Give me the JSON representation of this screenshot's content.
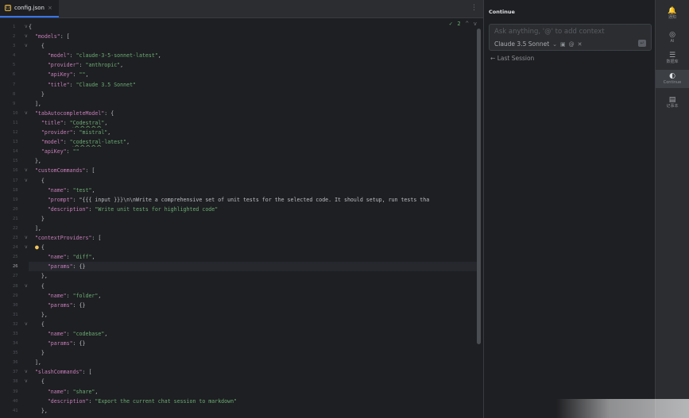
{
  "editor": {
    "tab": {
      "filename": "config.json",
      "close": "×"
    },
    "menu_icon": "⋮",
    "inspection": {
      "count": "2",
      "up": "^",
      "down": "v"
    },
    "current_line": 26,
    "lines": [
      {
        "n": "1",
        "t": "{",
        "fold": "v"
      },
      {
        "n": "2",
        "t": "  \"models\": [",
        "fold": "v"
      },
      {
        "n": "3",
        "t": "    {",
        "fold": "v"
      },
      {
        "n": "4",
        "t": "      \"model\": \"claude-3-5-sonnet-latest\","
      },
      {
        "n": "5",
        "t": "      \"provider\": \"anthropic\","
      },
      {
        "n": "6",
        "t": "      \"apiKey\": \"\","
      },
      {
        "n": "7",
        "t": "      \"title\": \"Claude 3.5 Sonnet\""
      },
      {
        "n": "8",
        "t": "    }"
      },
      {
        "n": "9",
        "t": "  ],"
      },
      {
        "n": "10",
        "t": "  \"tabAutocompleteModel\": {",
        "fold": "v"
      },
      {
        "n": "11",
        "t": "    \"title\": \"Codestral\","
      },
      {
        "n": "12",
        "t": "    \"provider\": \"mistral\","
      },
      {
        "n": "13",
        "t": "    \"model\": \"codestral-latest\","
      },
      {
        "n": "14",
        "t": "    \"apiKey\": \"\""
      },
      {
        "n": "15",
        "t": "  },"
      },
      {
        "n": "16",
        "t": "  \"customCommands\": [",
        "fold": "v"
      },
      {
        "n": "17",
        "t": "    {",
        "fold": "v"
      },
      {
        "n": "18",
        "t": "      \"name\": \"test\","
      },
      {
        "n": "19",
        "t": "      \"prompt\": \"{{{ input }}}\\n\\nWrite a comprehensive set of unit tests for the selected code. It should setup, run tests tha"
      },
      {
        "n": "20",
        "t": "      \"description\": \"Write unit tests for highlighted code\""
      },
      {
        "n": "21",
        "t": "    }"
      },
      {
        "n": "22",
        "t": "  ],"
      },
      {
        "n": "23",
        "t": "  \"contextProviders\": [",
        "fold": "v"
      },
      {
        "n": "24",
        "t": "    {",
        "fold": "v",
        "bulb": true
      },
      {
        "n": "25",
        "t": "      \"name\": \"diff\","
      },
      {
        "n": "26",
        "t": "      \"params\": {}"
      },
      {
        "n": "27",
        "t": "    },"
      },
      {
        "n": "28",
        "t": "    {",
        "fold": "v"
      },
      {
        "n": "29",
        "t": "      \"name\": \"folder\","
      },
      {
        "n": "30",
        "t": "      \"params\": {}"
      },
      {
        "n": "31",
        "t": "    },"
      },
      {
        "n": "32",
        "t": "    {",
        "fold": "v"
      },
      {
        "n": "33",
        "t": "      \"name\": \"codebase\","
      },
      {
        "n": "34",
        "t": "      \"params\": {}"
      },
      {
        "n": "35",
        "t": "    }"
      },
      {
        "n": "36",
        "t": "  ],"
      },
      {
        "n": "37",
        "t": "  \"slashCommands\": [",
        "fold": "v"
      },
      {
        "n": "38",
        "t": "    {",
        "fold": "v"
      },
      {
        "n": "39",
        "t": "      \"name\": \"share\","
      },
      {
        "n": "40",
        "t": "      \"description\": \"Export the current chat session to markdown\""
      },
      {
        "n": "41",
        "t": "    },"
      }
    ]
  },
  "panel": {
    "title": "Continue",
    "chat_placeholder": "Ask anything, '@' to add context",
    "model": "Claude 3.5 Sonnet",
    "model_chevron": "⌄",
    "last_session": "Last Session",
    "back_arrow": "←",
    "send_icon": "↵"
  },
  "right_sidebar": {
    "items": [
      {
        "icon": "bell-icon",
        "glyph": "🔔",
        "label": "通知"
      },
      {
        "icon": "ai-icon",
        "glyph": "◎",
        "label": "AI"
      },
      {
        "icon": "database-icon",
        "glyph": "☰",
        "label": "数据库"
      },
      {
        "icon": "continue-icon",
        "glyph": "◐",
        "label": "Continue",
        "active": true
      },
      {
        "icon": "notebook-icon",
        "glyph": "▤",
        "label": "记事本"
      }
    ]
  }
}
